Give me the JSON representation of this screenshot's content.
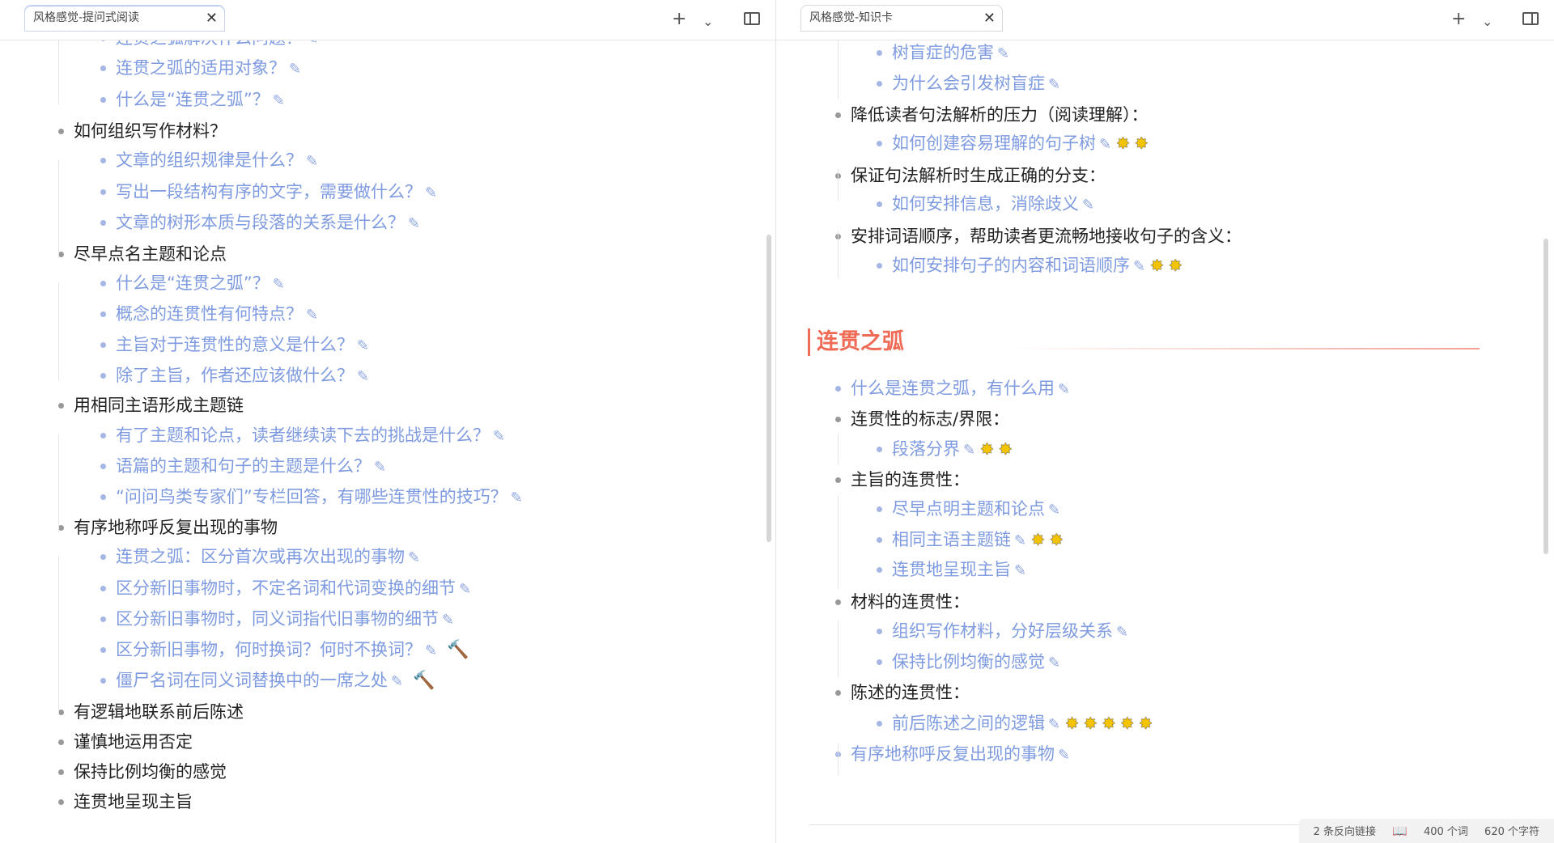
{
  "left": {
    "tab_title": "风格感觉-提问式阅读",
    "tab_close": "✕",
    "new_tab": "+",
    "tab_list": "⌄",
    "items": [
      {
        "level": 2,
        "text": "连贯之弧解决什么问题？",
        "mark": "pencil"
      },
      {
        "level": 2,
        "text": "连贯之弧的适用对象？",
        "mark": "pencil"
      },
      {
        "level": 2,
        "text": "什么是“连贯之弧”？",
        "mark": "pencil"
      },
      {
        "level": 1,
        "text": "如何组织写作材料？"
      },
      {
        "level": 2,
        "text": "文章的组织规律是什么？",
        "mark": "pencil"
      },
      {
        "level": 2,
        "text": "写出一段结构有序的文字，需要做什么？",
        "mark": "pencil"
      },
      {
        "level": 2,
        "text": "文章的树形本质与段落的关系是什么？",
        "mark": "pencil"
      },
      {
        "level": 1,
        "text": "尽早点名主题和论点"
      },
      {
        "level": 2,
        "text": "什么是“连贯之弧”？",
        "mark": "pencil"
      },
      {
        "level": 2,
        "text": "概念的连贯性有何特点？",
        "mark": "pencil"
      },
      {
        "level": 2,
        "text": "主旨对于连贯性的意义是什么？",
        "mark": "pencil"
      },
      {
        "level": 2,
        "text": "除了主旨，作者还应该做什么？",
        "mark": "pencil"
      },
      {
        "level": 1,
        "text": "用相同主语形成主题链"
      },
      {
        "level": 2,
        "text": "有了主题和论点，读者继续读下去的挑战是什么？",
        "mark": "pencil"
      },
      {
        "level": 2,
        "text": "语篇的主题和句子的主题是什么？",
        "mark": "pencil"
      },
      {
        "level": 2,
        "text": "“问问鸟类专家们”专栏回答，有哪些连贯性的技巧？",
        "mark": "pencil"
      },
      {
        "level": 1,
        "text": "有序地称呼反复出现的事物"
      },
      {
        "level": 2,
        "text": "连贯之弧：区分首次或再次出现的事物",
        "mark": "pencil"
      },
      {
        "level": 2,
        "text": "区分新旧事物时，不定名词和代词变换的细节",
        "mark": "pencil"
      },
      {
        "level": 2,
        "text": "区分新旧事物时，同义词指代旧事物的细节",
        "mark": "pencil"
      },
      {
        "level": 2,
        "text": "区分新旧事物，何时换词？何时不换词？",
        "mark": "pencil",
        "extra": "hammer"
      },
      {
        "level": 2,
        "text": "僵尸名词在同义词替换中的一席之处",
        "mark": "pencil",
        "extra": "hammer"
      },
      {
        "level": 1,
        "text": "有逻辑地联系前后陈述"
      },
      {
        "level": 1,
        "text": "谨慎地运用否定"
      },
      {
        "level": 1,
        "text": "保持比例均衡的感觉"
      },
      {
        "level": 1,
        "text": "连贯地呈现主旨"
      }
    ]
  },
  "right": {
    "tab_title": "风格感觉-知识卡",
    "tab_close": "✕",
    "new_tab": "+",
    "tab_list": "⌄",
    "items_top": [
      {
        "level": 2,
        "text": "树盲症的危害",
        "mark": "pencil"
      },
      {
        "level": 2,
        "text": "为什么会引发树盲症",
        "mark": "pencil"
      },
      {
        "level": 1,
        "text": "降低读者句法解析的压力（阅读理解）："
      },
      {
        "level": 2,
        "text": "如何创建容易理解的句子树",
        "mark": "pencil",
        "stars": 2
      },
      {
        "level": 1,
        "text": "保证句法解析时生成正确的分支："
      },
      {
        "level": 2,
        "text": "如何安排信息，消除歧义",
        "mark": "pencil"
      },
      {
        "level": 1,
        "text": "安排词语顺序，帮助读者更流畅地接收句子的含义："
      },
      {
        "level": 2,
        "text": "如何安排句子的内容和词语顺序",
        "mark": "pencil",
        "stars": 2
      }
    ],
    "heading": "连贯之弧",
    "items_bottom": [
      {
        "level": "1b",
        "text": "什么是连贯之弧，有什么用",
        "mark": "pencil"
      },
      {
        "level": 1,
        "text": "连贯性的标志/界限："
      },
      {
        "level": 2,
        "text": "段落分界",
        "mark": "pencil",
        "stars": 2
      },
      {
        "level": 1,
        "text": "主旨的连贯性："
      },
      {
        "level": 2,
        "text": "尽早点明主题和论点",
        "mark": "pencil"
      },
      {
        "level": 2,
        "text": "相同主语主题链",
        "mark": "pencil",
        "stars": 2
      },
      {
        "level": 2,
        "text": "连贯地呈现主旨",
        "mark": "pencil"
      },
      {
        "level": 1,
        "text": "材料的连贯性："
      },
      {
        "level": 2,
        "text": "组织写作材料，分好层级关系",
        "mark": "pencil"
      },
      {
        "level": 2,
        "text": "保持比例均衡的感觉",
        "mark": "pencil"
      },
      {
        "level": 1,
        "text": "陈述的连贯性："
      },
      {
        "level": 2,
        "text": "前后陈述之间的逻辑",
        "mark": "pencil",
        "stars": 5
      },
      {
        "level": "1b",
        "text": "有序地称呼反复出现的事物",
        "mark": "pencil"
      }
    ],
    "status": {
      "backlinks": "2 条反向链接",
      "words": "400 个词",
      "chars": "620 个字符"
    }
  },
  "colors": {
    "link": "#7f9be0",
    "heading": "#ef6b55",
    "text": "#222222"
  }
}
